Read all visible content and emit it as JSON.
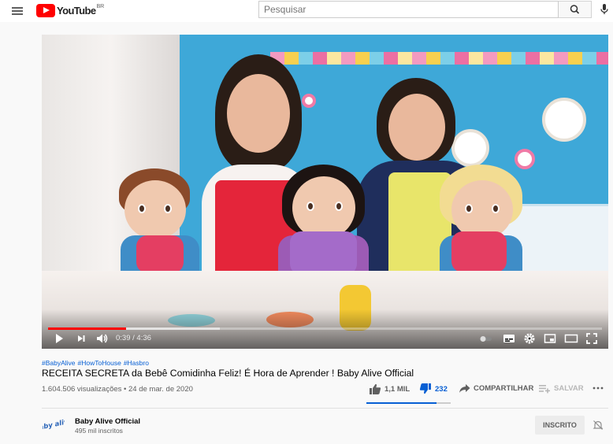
{
  "masthead": {
    "logo_text": "YouTube",
    "country_code": "BR",
    "search_placeholder": "Pesquisar",
    "icons": [
      "menu-icon",
      "search-icon",
      "microphone-icon"
    ]
  },
  "player": {
    "current_time": "0:39 / 4:36",
    "progress_fraction": 0.141,
    "buffer_fraction": 0.31,
    "icons": [
      "play-icon",
      "next-icon",
      "volume-icon",
      "autoplay-toggle-icon",
      "subtitles-icon",
      "settings-icon",
      "miniplayer-icon",
      "theater-mode-icon",
      "fullscreen-icon"
    ]
  },
  "video": {
    "hashtags": [
      "#BabyAlive",
      "#HowToHouse",
      "#Hasbro"
    ],
    "title": "RECEITA SECRETA da Bebê Comidinha Feliz! É Hora de Aprender ! Baby Alive Official",
    "views": "1.604.506 visualizações",
    "separator": "•",
    "date": "24 de mar. de 2020"
  },
  "actions": {
    "like_count": "1,1 MIL",
    "dislike_count": "232",
    "share_label": "COMPARTILHAR",
    "save_label": "SALVAR",
    "like_fraction": 0.83
  },
  "channel": {
    "name": "Baby Alive Official",
    "subscribers": "495 mil inscritos",
    "subscribe_label": "INSCRITO",
    "avatar_text": "baby alive"
  },
  "colors": {
    "accent_red": "#ff0000",
    "link_blue": "#065fd4",
    "background": "#f9f9f9"
  }
}
